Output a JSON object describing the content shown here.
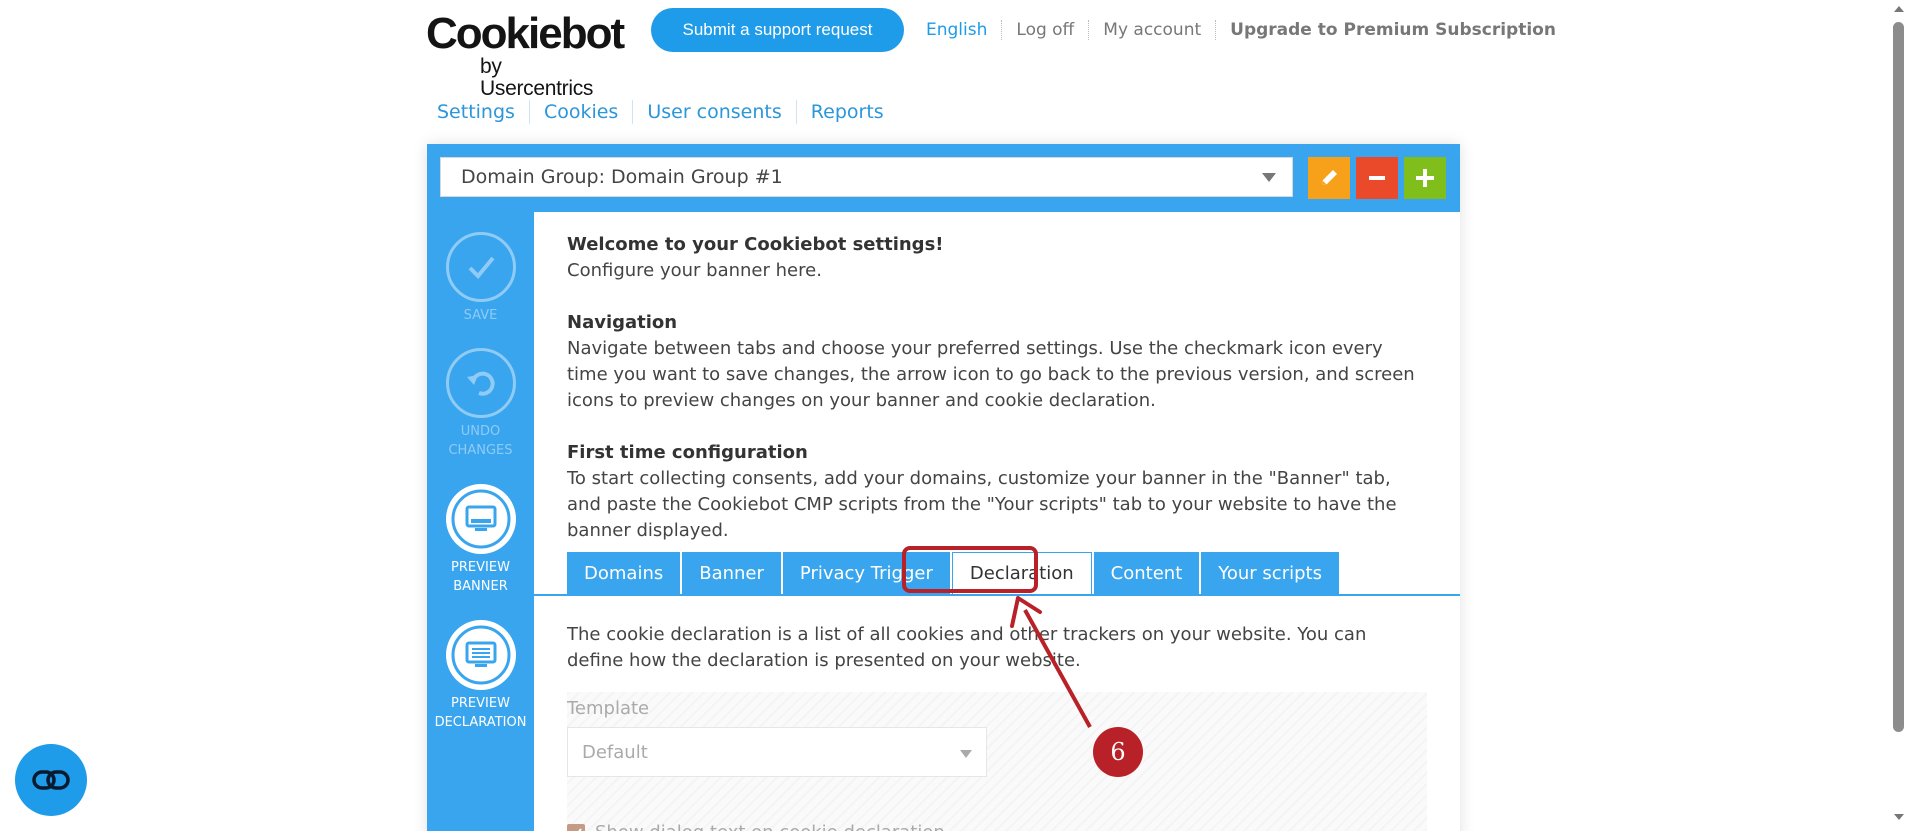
{
  "header": {
    "logo_brand": "Cookiebot",
    "logo_sub": "by Usercentrics",
    "support_button": "Submit a support request",
    "links": [
      "English",
      "Log off",
      "My account",
      "Upgrade to Premium Subscription"
    ]
  },
  "main_nav": [
    "Settings",
    "Cookies",
    "User consents",
    "Reports"
  ],
  "domain_group": {
    "selected": "Domain Group: Domain Group #1"
  },
  "sidebar": {
    "save": "SAVE",
    "undo_1": "UNDO",
    "undo_2": "CHANGES",
    "preview_banner_1": "PREVIEW",
    "preview_banner_2": "BANNER",
    "preview_decl_1": "PREVIEW",
    "preview_decl_2": "DECLARATION"
  },
  "intro": {
    "welcome_title": "Welcome to your Cookiebot settings!",
    "welcome_text": "Configure your banner here.",
    "nav_title": "Navigation",
    "nav_text": "Navigate between tabs and choose your preferred settings. Use the checkmark icon every time you want to save changes, the arrow icon to go back to the previous version, and screen icons to preview changes on your banner and cookie declaration.",
    "first_title": "First time configuration",
    "first_text": "To start collecting consents, add your domains, customize your banner in the \"Banner\" tab, and paste the Cookiebot CMP scripts from the \"Your scripts\" tab to your website to have the banner displayed."
  },
  "tabs": [
    "Domains",
    "Banner",
    "Privacy Trigger",
    "Declaration",
    "Content",
    "Your scripts"
  ],
  "active_tab": "Declaration",
  "declaration": {
    "description": "The cookie declaration is a list of all cookies and other trackers on your website. You can define how the declaration is presented on your website.",
    "template_label": "Template",
    "template_value": "Default",
    "checkbox_label": "Show dialog text on cookie declaration"
  },
  "annotation": {
    "step_number": "6"
  },
  "colors": {
    "accent_blue": "#38a5ee",
    "support_blue": "#1e9be9",
    "edit_orange": "#f7a11a",
    "minus_red": "#ea4a2a",
    "plus_green": "#80be1c",
    "annotation_red": "#b82128"
  }
}
